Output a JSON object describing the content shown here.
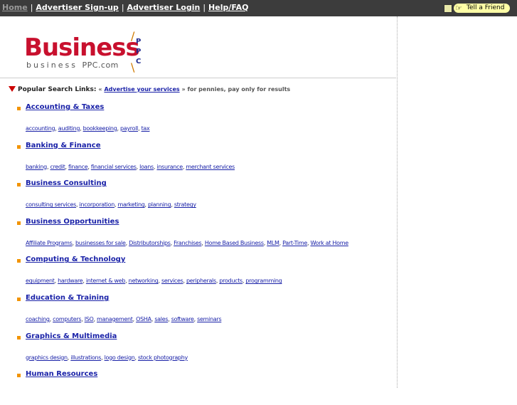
{
  "topnav": {
    "items": [
      {
        "label": "Home"
      },
      {
        "label": "Advertiser Sign-up"
      },
      {
        "label": "Advertiser Login"
      },
      {
        "label": "Help/FAQ"
      }
    ],
    "separator": "|"
  },
  "tell_friend": {
    "label": "Tell a Friend",
    "icon": "pointing-hand-icon"
  },
  "logo": {
    "word": "Business",
    "sub_prefix": "business",
    "sub_suffix": "PPC.com",
    "ppc_letters": [
      "P",
      "P",
      "C"
    ]
  },
  "popular": {
    "label": "Popular Search Links:",
    "prefix": "«",
    "link": "Advertise your services",
    "suffix": "» for pennies, pay only for results"
  },
  "categories": [
    {
      "title": "Accounting & Taxes",
      "subs": [
        "accounting",
        "auditing",
        "bookkeeping",
        "payroll",
        "tax"
      ]
    },
    {
      "title": "Banking & Finance",
      "subs": [
        "banking",
        "credit",
        "finance",
        "financial services",
        "loans",
        "insurance",
        "merchant services"
      ]
    },
    {
      "title": "Business Consulting",
      "subs": [
        "consulting services",
        "incorporation",
        "marketing",
        "planning",
        "strategy"
      ]
    },
    {
      "title": "Business Opportunities",
      "subs": [
        "Affiliate Programs",
        "businesses for sale",
        "Distributorships",
        "Franchises",
        "Home Based Business",
        "MLM",
        "Part-Time",
        "Work at Home"
      ]
    },
    {
      "title": "Computing & Technology",
      "subs": [
        "equipment",
        "hardware",
        "internet & web",
        "networking",
        "services",
        "peripherals",
        "products",
        "programming"
      ]
    },
    {
      "title": "Education & Training",
      "subs": [
        "coaching",
        "computers",
        "ISO",
        "management",
        "OSHA",
        "sales",
        "software",
        "seminars"
      ]
    },
    {
      "title": "Graphics & Multimedia",
      "subs": [
        "graphics design",
        "illustrations",
        "logo design",
        "stock photography"
      ]
    },
    {
      "title": "Human Resources",
      "subs": []
    }
  ],
  "colors": {
    "topbar": "#3c3c3c",
    "brand_red": "#c8102e",
    "link_blue": "#1a22a8",
    "bullet_orange": "#f29400",
    "triangle_red": "#cc0000"
  }
}
